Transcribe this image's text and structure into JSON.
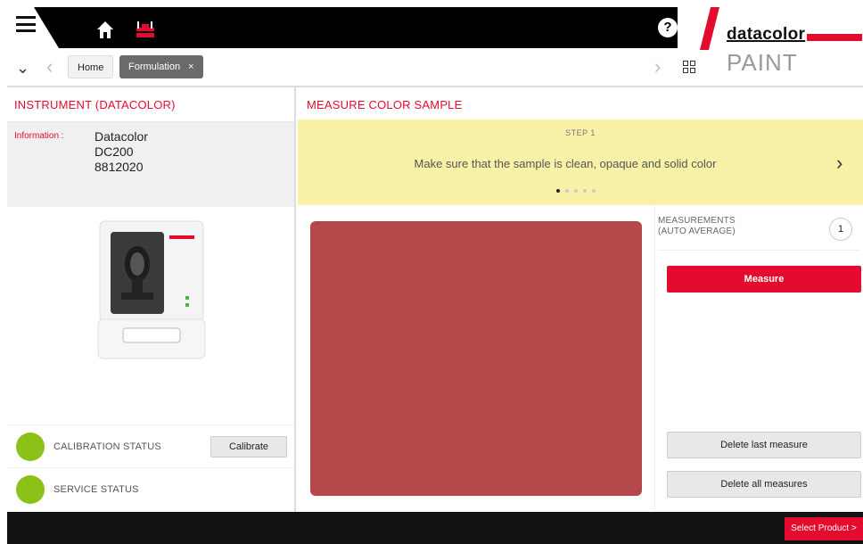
{
  "header": {
    "brand_name": "datacolor",
    "brand_product": "PAINT",
    "help_label": "?",
    "accent_color": "#e30b2e"
  },
  "nav": {
    "breadcrumbs": [
      "Home",
      "Formulation"
    ],
    "close_glyph": "×"
  },
  "instrument_panel": {
    "title": "INSTRUMENT (DATACOLOR)",
    "info_label": "Information :",
    "info_lines": [
      "Datacolor",
      "DC200",
      "8812020"
    ],
    "calibration_label": "CALIBRATION STATUS",
    "calibrate_button": "Calibrate",
    "service_label": "SERVICE STATUS",
    "status_color": "#8cc218"
  },
  "measure_panel": {
    "title": "MEASURE COLOR SAMPLE",
    "step_label": "STEP 1",
    "step_text": "Make sure that the sample is clean, opaque and solid color",
    "step_dots": 5,
    "active_dot": 0,
    "sample_color": "#b4484b",
    "measurements_label_line1": "MEASUREMENTS",
    "measurements_label_line2": "(AUTO AVERAGE)",
    "measurement_count": "1",
    "measure_button": "Measure",
    "delete_last_button": "Delete last measure",
    "delete_all_button": "Delete all measures"
  },
  "footer": {
    "select_product_button": "Select Product >"
  }
}
